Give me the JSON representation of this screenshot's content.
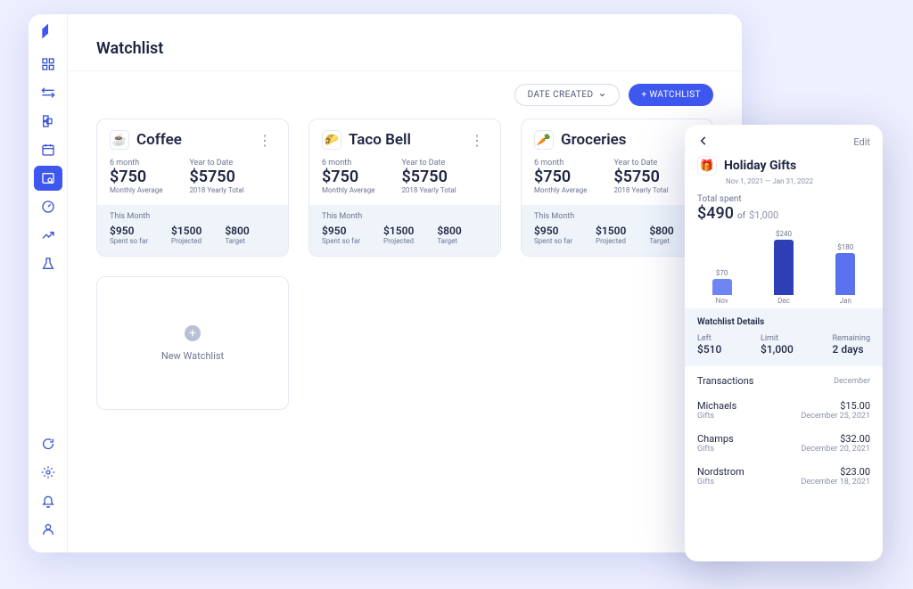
{
  "page": {
    "title": "Watchlist"
  },
  "toolbar": {
    "sort_label": "DATE CREATED",
    "add_label": "+ WATCHLIST"
  },
  "cards": [
    {
      "emoji": "☕",
      "title": "Coffee",
      "six_month": {
        "label": "6 month",
        "value": "$750",
        "sub": "Monthly Average"
      },
      "ytd": {
        "label": "Year to Date",
        "value": "$5750",
        "sub": "2018 Yearly Total"
      },
      "this_month_label": "This Month",
      "stats": [
        {
          "value": "$950",
          "label": "Spent so far"
        },
        {
          "value": "$1500",
          "label": "Projected"
        },
        {
          "value": "$800",
          "label": "Target"
        }
      ]
    },
    {
      "emoji": "🌮",
      "title": "Taco Bell",
      "six_month": {
        "label": "6 month",
        "value": "$750",
        "sub": "Monthly Average"
      },
      "ytd": {
        "label": "Year to Date",
        "value": "$5750",
        "sub": "2018 Yearly Total"
      },
      "this_month_label": "This Month",
      "stats": [
        {
          "value": "$950",
          "label": "Spent so far"
        },
        {
          "value": "$1500",
          "label": "Projected"
        },
        {
          "value": "$800",
          "label": "Target"
        }
      ]
    },
    {
      "emoji": "🥕",
      "title": "Groceries",
      "six_month": {
        "label": "6 month",
        "value": "$750",
        "sub": "Monthly Average"
      },
      "ytd": {
        "label": "Year to Date",
        "value": "$5750",
        "sub": "2018 Yearly Total"
      },
      "this_month_label": "This Month",
      "stats": [
        {
          "value": "$950",
          "label": "Spent so far"
        },
        {
          "value": "$1500",
          "label": "Projected"
        },
        {
          "value": "$800",
          "label": "Target"
        }
      ]
    }
  ],
  "new_card_label": "New Watchlist",
  "mobile": {
    "edit": "Edit",
    "emoji": "🎁",
    "title": "Holiday Gifts",
    "dates": "Nov 1, 2021 — Jan 31, 2022",
    "spent": {
      "label": "Total spent",
      "value": "$490",
      "of": "of",
      "limit": "$1,000"
    },
    "details": {
      "heading": "Watchlist Details",
      "left": {
        "label": "Left",
        "value": "$510"
      },
      "limit": {
        "label": "Limit",
        "value": "$1,000"
      },
      "remaining": {
        "label": "Remaining",
        "value": "2 days"
      }
    },
    "transactions": {
      "heading": "Transactions",
      "month": "December",
      "items": [
        {
          "name": "Michaels",
          "category": "Gifts",
          "amount": "$15.00",
          "date": "December 25, 2021"
        },
        {
          "name": "Champs",
          "category": "Gifts",
          "amount": "$32.00",
          "date": "December 20, 2021"
        },
        {
          "name": "Nordstrom",
          "category": "Gifts",
          "amount": "$23.00",
          "date": "December 18, 2021"
        }
      ]
    }
  },
  "chart_data": {
    "type": "bar",
    "categories": [
      "Nov",
      "Dec",
      "Jan"
    ],
    "values": [
      70,
      240,
      180
    ],
    "value_labels": [
      "$70",
      "$240",
      "$180"
    ],
    "colors": [
      "#6f85f4",
      "#2d3fb2",
      "#5a71f0"
    ],
    "title": "",
    "xlabel": "",
    "ylabel": "",
    "ylim": [
      0,
      240
    ]
  }
}
